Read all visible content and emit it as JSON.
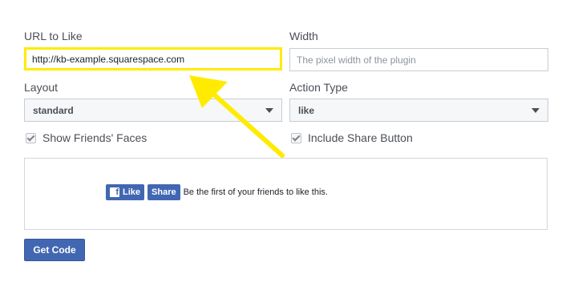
{
  "form": {
    "url_label": "URL to Like",
    "url_value": "http://kb-example.squarespace.com",
    "width_label": "Width",
    "width_placeholder": "The pixel width of the plugin",
    "layout_label": "Layout",
    "layout_value": "standard",
    "action_label": "Action Type",
    "action_value": "like",
    "show_faces_label": "Show Friends' Faces",
    "show_faces_checked": true,
    "share_label": "Include Share Button",
    "share_checked": true
  },
  "preview": {
    "like_label": "Like",
    "share_label": "Share",
    "social_text": "Be the first of your friends to like this."
  },
  "actions": {
    "get_code_label": "Get Code"
  },
  "annotation": {
    "arrow_color": "#ffeb00",
    "highlight_color": "#ffeb00"
  },
  "colors": {
    "facebook_blue": "#4267b2"
  }
}
